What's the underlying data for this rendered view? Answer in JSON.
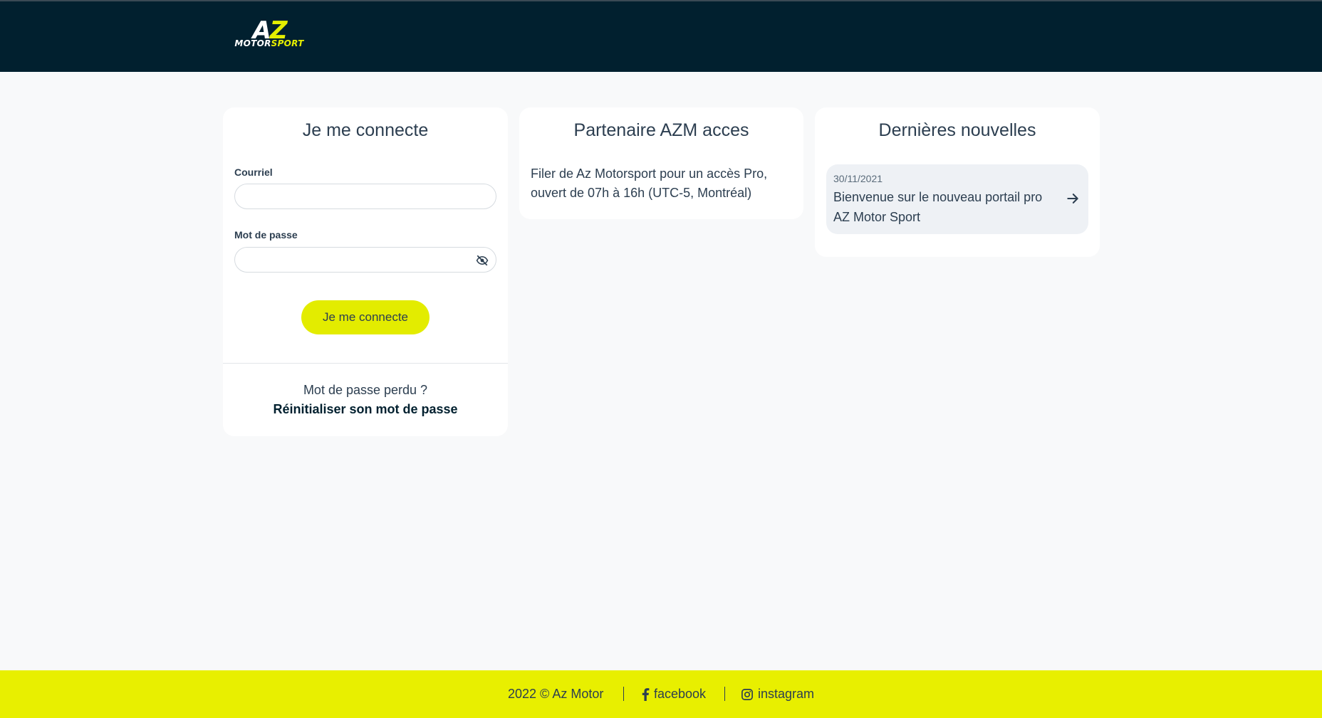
{
  "brand": {
    "logo_letters_a": "A",
    "logo_letters_z": "Z",
    "logo_word_1": "MOTOR",
    "logo_word_2": "SPORT",
    "colors": {
      "header": "#01202f",
      "accent": "#e5ee00",
      "footer": "#e8ef00"
    }
  },
  "login": {
    "title": "Je me connecte",
    "email_label": "Courriel",
    "email_value": "",
    "password_label": "Mot de passe",
    "password_value": "",
    "toggle_icon": "eye-slash-icon",
    "submit_label": "Je me connecte",
    "lost_password_text": "Mot de passe perdu ?",
    "reset_link": "Réinitialiser son mot de passe"
  },
  "partner": {
    "title": "Partenaire AZM acces",
    "text": "Filer de Az Motorsport pour un accès Pro, ouvert de 07h à 16h (UTC-5, Montréal)"
  },
  "news": {
    "title": "Dernières nouvelles",
    "items": [
      {
        "date": "30/11/2021",
        "title": "Bienvenue sur le nouveau portail pro AZ Motor Sport",
        "icon": "arrow-right-icon"
      }
    ]
  },
  "footer": {
    "copyright": "2022 © Az Motor",
    "facebook": "facebook",
    "instagram": "instagram"
  }
}
